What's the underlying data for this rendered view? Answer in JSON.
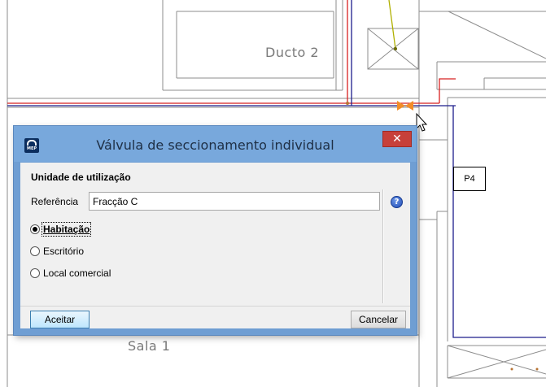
{
  "drawing": {
    "room_labels": {
      "ducto": "Ducto 2",
      "sala": "Sala 1",
      "pillar": "P4"
    },
    "colors": {
      "wall": "#8c8c8c",
      "pipe_red": "#d82020",
      "pipe_blue": "#1e1e8c",
      "valve": "#f28c28"
    }
  },
  "dialog": {
    "title": "Válvula de seccionamento individual",
    "app_icon_text": "MEP",
    "close_symbol": "✕",
    "group_title": "Unidade de utilização",
    "reference": {
      "label": "Referência",
      "value": "Fracção C"
    },
    "help_symbol": "?",
    "options": [
      {
        "label": "Habitação",
        "selected": true
      },
      {
        "label": "Escritório",
        "selected": false
      },
      {
        "label": "Local comercial",
        "selected": false
      }
    ],
    "accept_label": "Aceitar",
    "cancel_label": "Cancelar",
    "colors": {
      "titlebar": "#78a8dc",
      "close_button": "#c7403a"
    }
  }
}
